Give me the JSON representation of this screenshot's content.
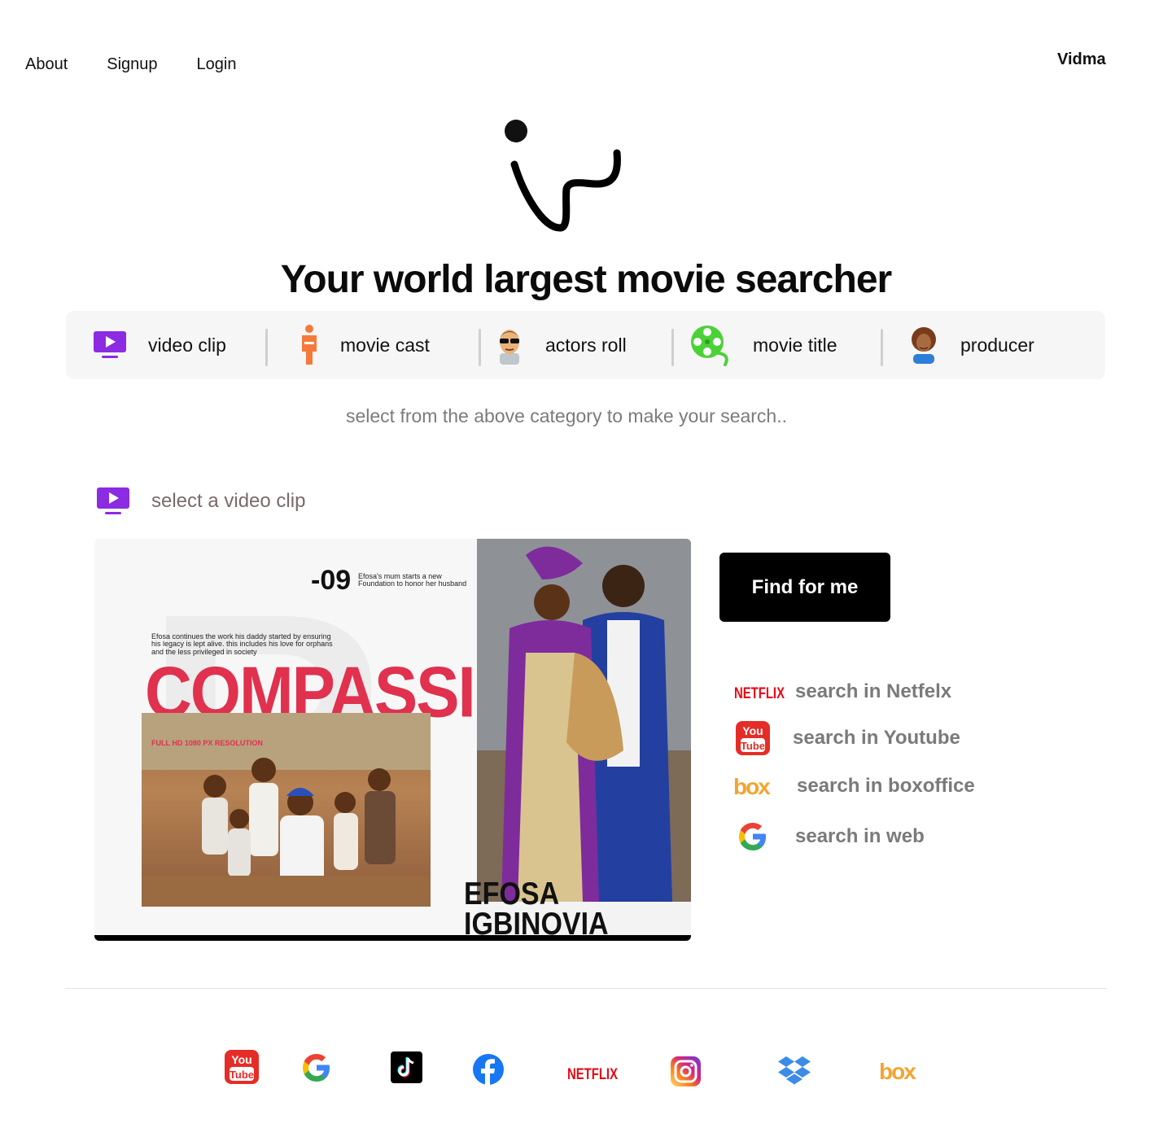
{
  "nav": {
    "about": "About",
    "signup": "Signup",
    "login": "Login"
  },
  "brand": "Vidma",
  "hero": {
    "title": "Your world largest movie searcher"
  },
  "categories": [
    {
      "label": "video clip",
      "icon": "tv-play-icon"
    },
    {
      "label": "movie cast",
      "icon": "person-icon"
    },
    {
      "label": "actors roll",
      "icon": "sunglasses-man-icon"
    },
    {
      "label": "movie title",
      "icon": "film-reel-icon"
    },
    {
      "label": "producer",
      "icon": "woman-producer-icon"
    }
  ],
  "hint": "select from the above category to make your search..",
  "selection": {
    "label": "select a video clip",
    "icon": "tv-play-icon"
  },
  "video": {
    "episode": "-09",
    "episode_note": "Efosa's mum starts a new Foundation to honor her husband",
    "story": "Efosa continues the work his daddy started by ensuring his legacy is lept alive. this includes his love for orphans and the less privileged in society",
    "headline": "COMPASSION",
    "hd_tag": "FULL HD 1080 PX RESOLUTION",
    "name_line1": "EFOSA",
    "name_line2": "IGBINOVIA"
  },
  "find_button": "Find for me",
  "search_options": [
    {
      "label": "search in Netfelx",
      "icon": "netflix-icon"
    },
    {
      "label": "search in Youtube",
      "icon": "youtube-icon"
    },
    {
      "label": "search in boxoffice",
      "icon": "box-icon"
    },
    {
      "label": "search in web",
      "icon": "google-icon"
    }
  ],
  "icon_text": {
    "netflix": "NETFLIX",
    "youtube_top": "You",
    "youtube_bottom": "Tube",
    "box": "box"
  },
  "footer_icons": [
    "youtube-icon",
    "google-icon",
    "tiktok-icon",
    "facebook-icon",
    "netflix-icon",
    "instagram-icon",
    "dropbox-icon",
    "box-icon"
  ],
  "colors": {
    "accent_purple": "#8b2be2",
    "button_bg": "#000000",
    "netflix_red": "#e50914",
    "box_orange": "#f2a531",
    "compassion_red": "#e0314e",
    "hint_text": "#7b7b7b"
  }
}
